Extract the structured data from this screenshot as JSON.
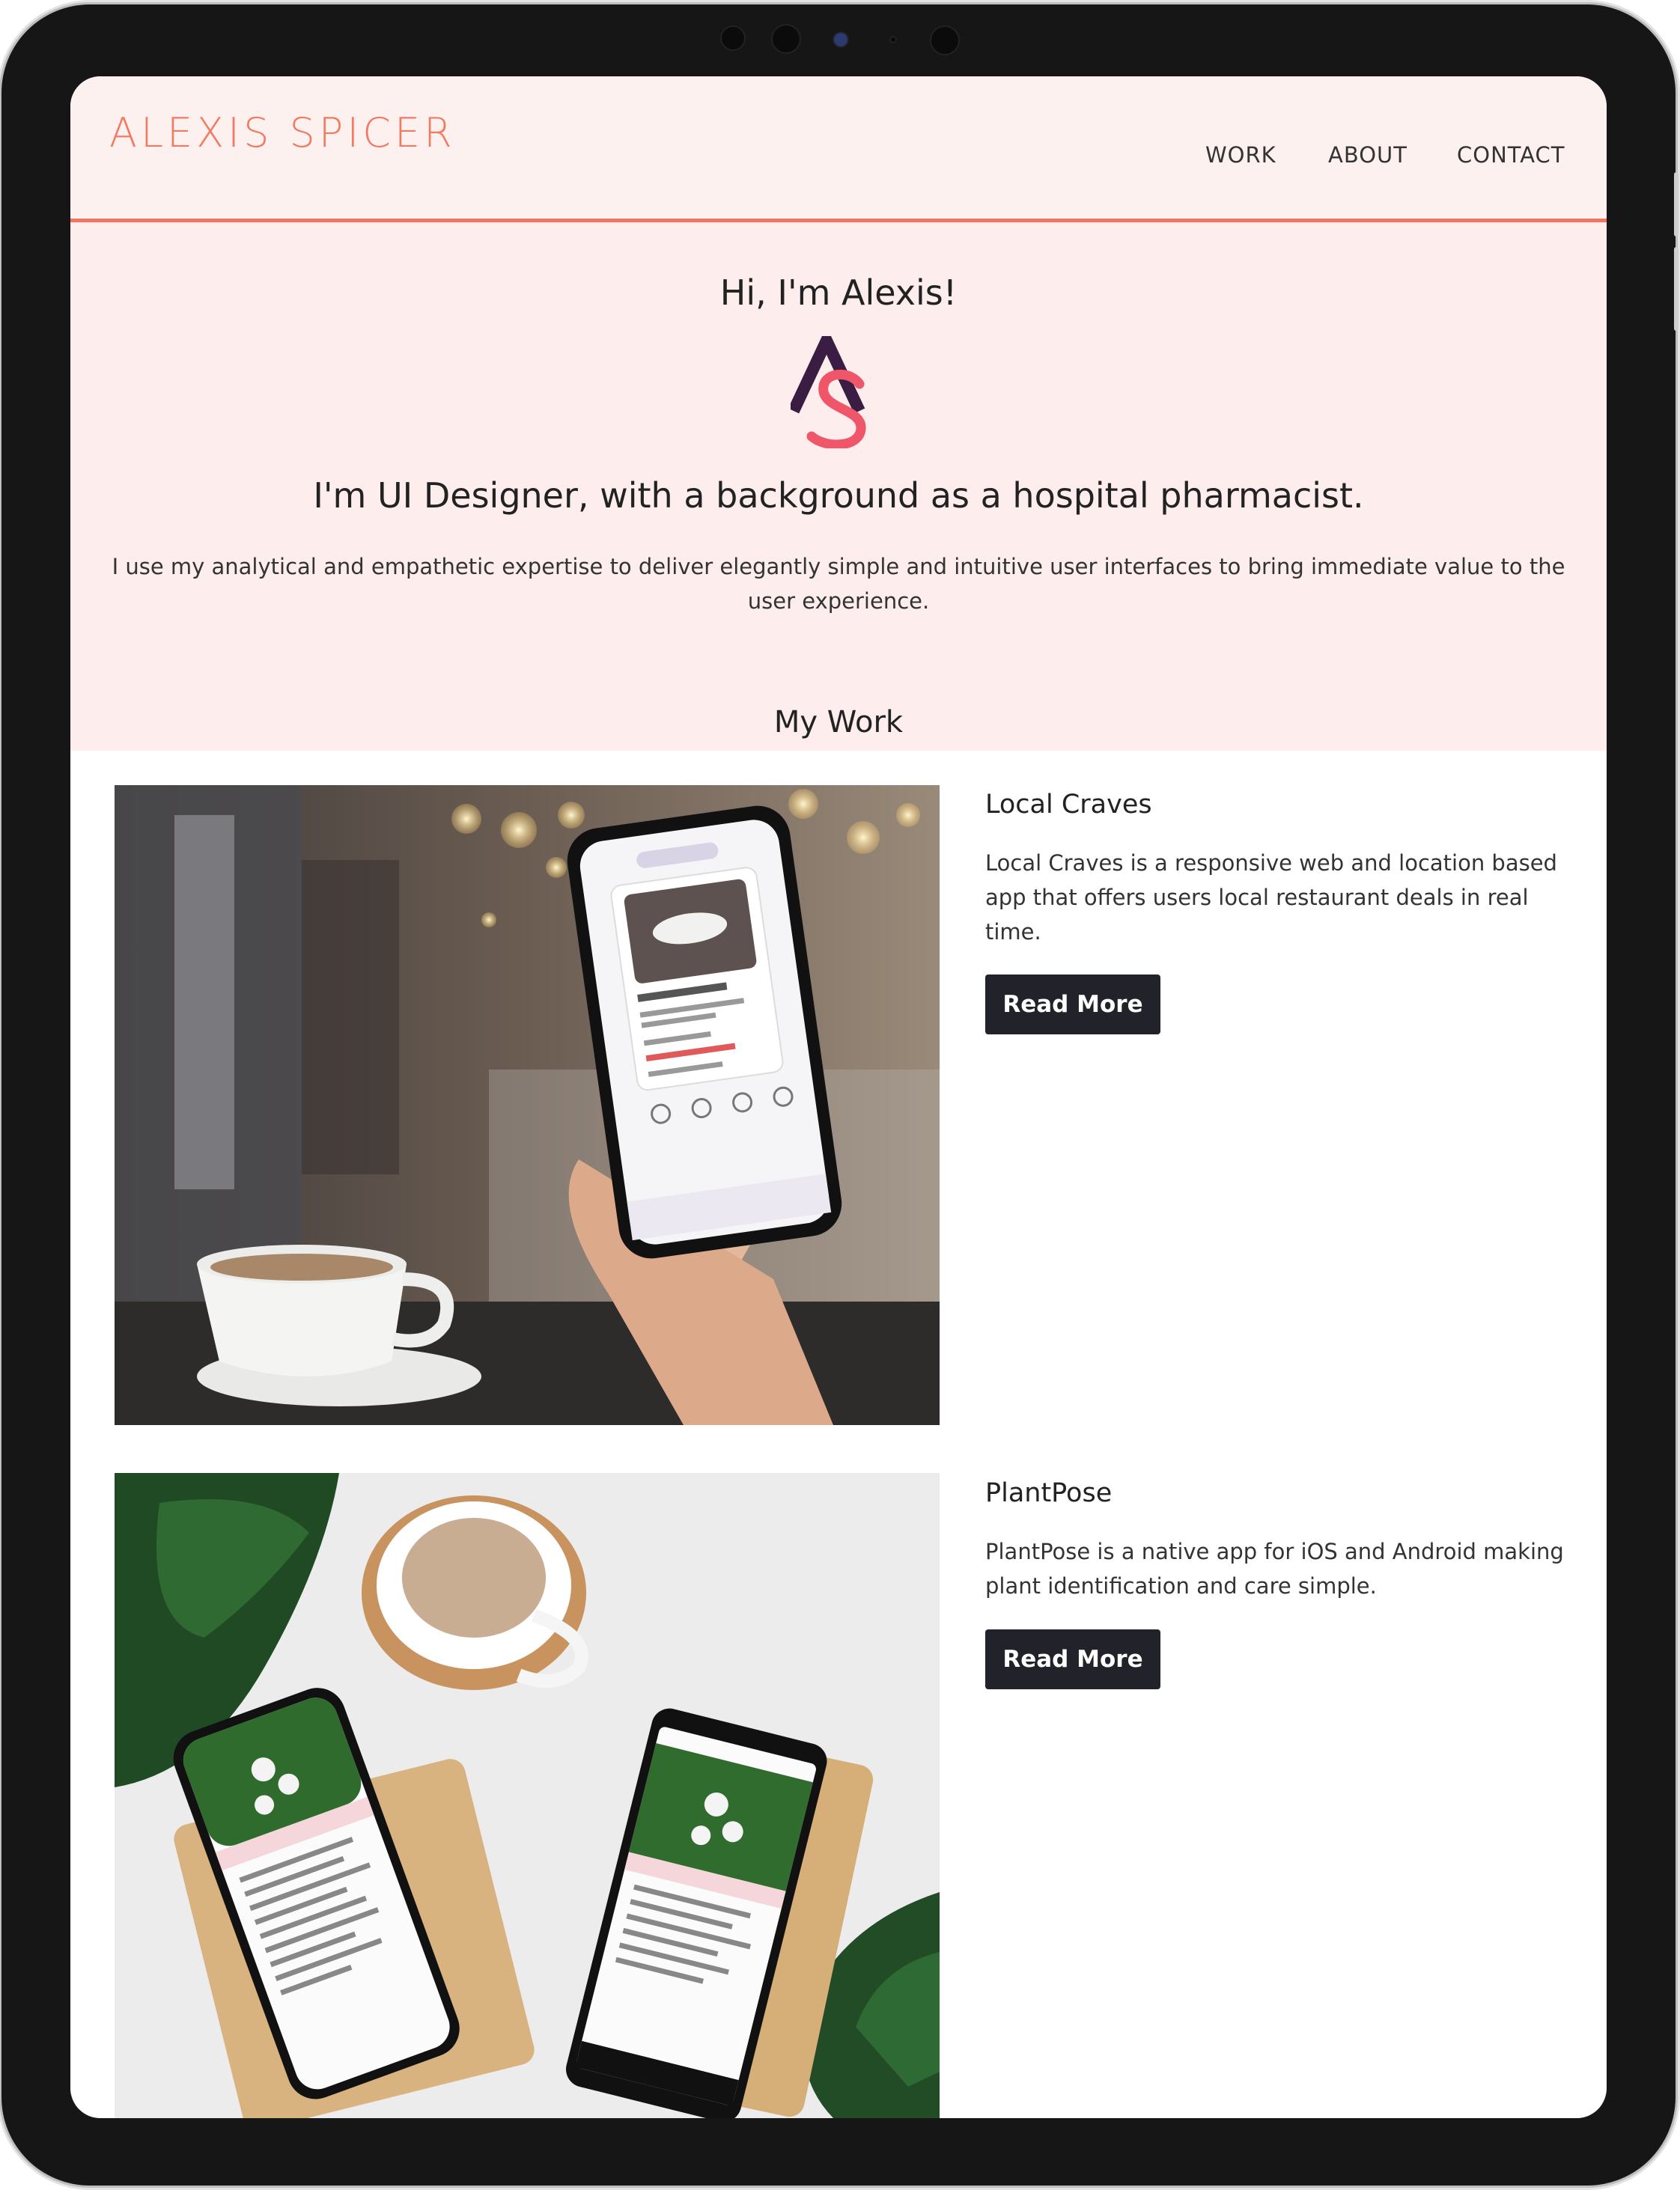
{
  "header": {
    "logo": "ALEXIS SPICER",
    "nav": [
      {
        "label": "WORK"
      },
      {
        "label": "ABOUT"
      },
      {
        "label": "CONTACT"
      }
    ]
  },
  "hero": {
    "greeting": "Hi, I'm Alexis!",
    "monogram": "AS",
    "tagline": "I'm UI Designer, with a background as a hospital pharmacist.",
    "intro": "I use my analytical and empathetic expertise to deliver elegantly simple and intuitive user interfaces to bring immediate value to the user experience."
  },
  "work": {
    "title": "My Work",
    "projects": [
      {
        "title": "Local Craves",
        "description": "Local Craves is a responsive web and location based app that offers users local restaurant deals in real time.",
        "button": "Read More"
      },
      {
        "title": "PlantPose",
        "description": "PlantPose is a native app for iOS and Android making plant identification and care simple.",
        "button": "Read More"
      }
    ]
  },
  "colors": {
    "accent": "#f17561",
    "hero_bg": "#fdeeed",
    "button_bg": "#22222b",
    "text": "#222222"
  }
}
